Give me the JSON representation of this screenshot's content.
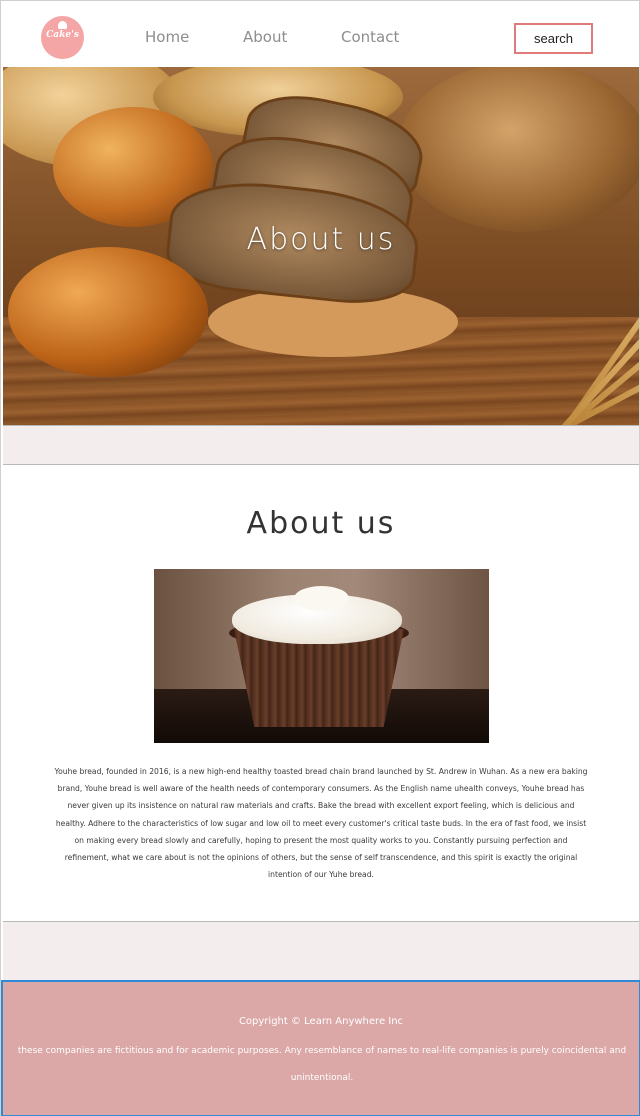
{
  "header": {
    "logo_text": "Cake's",
    "nav": [
      {
        "label": "Home"
      },
      {
        "label": "About"
      },
      {
        "label": "Contact"
      }
    ],
    "search_label": "search"
  },
  "hero": {
    "title": "About us"
  },
  "about": {
    "title": "About us",
    "body": "Youhe bread, founded in 2016, is a new high-end healthy toasted bread chain brand launched by St. Andrew in Wuhan. As a new era baking brand, Youhe bread is well aware of the health needs of contemporary consumers. As the English name uhealth conveys, Youhe bread has never given up its insistence on natural raw materials and crafts. Bake the bread with excellent export feeling, which is delicious and healthy. Adhere to the characteristics of low sugar and low oil to meet every customer's critical taste buds. In the era of fast food, we insist on making every bread slowly and carefully, hoping to present the most quality works to you. Constantly pursuing perfection and refinement, what we care about is not the opinions of others, but the sense of self transcendence, and this spirit is exactly the original intention of our Yuhe bread."
  },
  "footer": {
    "copyright": "Copyright © Learn Anywhere Inc",
    "disclaimer": "these companies are fictitious and for academic purposes. Any resemblance of names to real-life companies is purely coincidental and unintentional."
  },
  "colors": {
    "accent": "#e07b7b",
    "logo": "#f4a5a5",
    "band": "#f3eded",
    "footer": "#dba7a7",
    "footer_border": "#2f8ad6"
  }
}
